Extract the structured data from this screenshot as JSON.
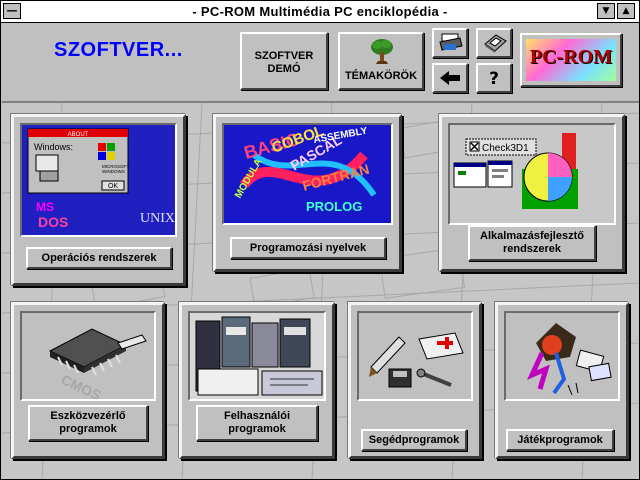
{
  "window": {
    "title": "- PC-ROM Multimédia PC enciklopédia -",
    "minimize_icon": "triangle-down-icon",
    "maximize_icon": "triangle-up-icon",
    "system_menu_icon": "system-menu-icon"
  },
  "header": {
    "heading": "SZOFTVER...",
    "heading_color": "#0000ff",
    "demo_button_line1": "SZOFTVER",
    "demo_button_line2": "DEMÓ",
    "topics_button": "TÉMAKÖRÖK",
    "back_icon": "arrow-left-icon",
    "help_label": "?",
    "logo_text": "PC-ROM"
  },
  "categories": [
    {
      "label": "Operációs rendszerek",
      "image": "operating-systems-image"
    },
    {
      "label": "Programozási nyelvek",
      "image": "programming-languages-image"
    },
    {
      "label_line1": "Alkalmazásfejlesztő",
      "label_line2": "rendszerek",
      "image": "app-dev-image"
    },
    {
      "label_line1": "Eszközvezérlő",
      "label_line2": "programok",
      "image": "device-driver-image"
    },
    {
      "label_line1": "Felhasználói",
      "label_line2": "programok",
      "image": "user-programs-image"
    },
    {
      "label": "Segédprogramok",
      "image": "utilities-image"
    },
    {
      "label": "Játékprogramok",
      "image": "games-image"
    }
  ],
  "thumbnail_text": {
    "os_window_title": "ABOUT",
    "os_windows_label": "Windows:",
    "os_ok": "OK",
    "os_ms": "MS",
    "os_dos": "DOS",
    "os_unix": "UNIX",
    "os_logo_text1": "MICROSOFT",
    "os_logo_text2": "WINDOWS",
    "lang_words": [
      "BASIC",
      "COBOL",
      "PASCAL",
      "ASSEMBLY",
      "FORTRAN",
      "PROLOG",
      "MODULA"
    ],
    "check_label": "Check3D1",
    "cmos_label": "CMOS"
  }
}
